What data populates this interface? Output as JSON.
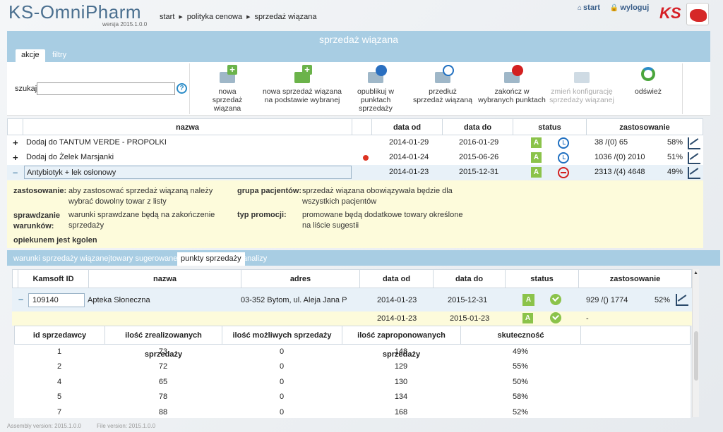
{
  "header": {
    "app_name": "KS-OmniPharm",
    "version": "wersja  2015.1.0.0",
    "breadcrumb": [
      "start",
      "polityka cenowa",
      "sprzedaż wiązana"
    ],
    "link_start": "start",
    "link_logout": "wyloguj",
    "ks_logo": "KS"
  },
  "page_title": "sprzedaż wiązana",
  "tabs": [
    "akcje",
    "filtry"
  ],
  "toolbar": {
    "search_label": "szukaj",
    "search_value": "",
    "help": "?",
    "buttons": [
      {
        "l1": "nowa",
        "l2": "sprzedaż wiązana",
        "enabled": true
      },
      {
        "l1": "nowa sprzedaż wiązana",
        "l2": "na podstawie wybranej",
        "enabled": true
      },
      {
        "l1": "opublikuj w",
        "l2": "punktach sprzedaży",
        "enabled": true
      },
      {
        "l1": "przedłuż",
        "l2": "sprzedaż wiązaną",
        "enabled": true
      },
      {
        "l1": "zakończ w",
        "l2": "wybranych punktach",
        "enabled": true
      },
      {
        "l1": "zmień konfigurację",
        "l2": "sprzedaży wiązanej",
        "enabled": false
      },
      {
        "l1": "odśwież",
        "l2": "",
        "enabled": true
      }
    ]
  },
  "main_table": {
    "columns": [
      "nazwa",
      "data od",
      "data do",
      "status",
      "zastosowanie"
    ],
    "rows": [
      {
        "expander": "+",
        "name": "Dodaj do TANTUM VERDE - PROPOLKI",
        "from": "2014-01-29",
        "to": "2016-01-29",
        "badge": "A",
        "status_icon": "clock-icon",
        "usage": "38 /(0) 65",
        "pct": "58%",
        "flag": false
      },
      {
        "expander": "+",
        "name": "Dodaj do Żelek Marsjanki",
        "from": "2014-01-24",
        "to": "2015-06-26",
        "badge": "A",
        "status_icon": "clock-icon",
        "usage": "1036 /(0) 2010",
        "pct": "51%",
        "flag": true
      },
      {
        "expander": "–",
        "name": "Antybiotyk + lek osłonowy",
        "from": "2014-01-23",
        "to": "2015-12-31",
        "badge": "A",
        "status_icon": "stop-icon",
        "usage": "2313 /(4) 4648",
        "pct": "49%",
        "flag": false
      }
    ]
  },
  "detail": {
    "zast_label": "zastosowanie:",
    "zast_value": "aby zastosować sprzedaż wiązaną należy wybrać dowolny towar z listy",
    "grupa_label": "grupa pacjentów:",
    "grupa_value": "sprzedaż wiązana obowiązywała będzie dla wszystkich pacjentów",
    "spr_label": "sprawdzanie warunków:",
    "spr_value": "warunki sprawdzane będą na zakończenie sprzedaży",
    "typ_label": "typ promocji:",
    "typ_value": "promowane będą dodatkowe towary określone na liście sugestii",
    "owner": "opiekunem jest kgolen"
  },
  "sub_tabs": [
    "warunki sprzedaży wiązanej",
    "towary sugerowane",
    "punkty sprzedaży",
    "analizy"
  ],
  "sub_table": {
    "columns": [
      "Kamsoft ID",
      "nazwa",
      "adres",
      "data od",
      "data do",
      "status",
      "zastosowanie"
    ],
    "row": {
      "expander": "–",
      "id": "109140",
      "name": "Apteka Słoneczna",
      "address": "03-352 Bytom, ul. Aleja Jana Paw",
      "from": "2014-01-23",
      "to": "2015-12-31",
      "badge": "A",
      "usage": "929 /() 1774",
      "pct": "52%"
    },
    "row2": {
      "from": "2014-01-23",
      "to": "2015-01-23",
      "badge": "A",
      "usage": "-"
    }
  },
  "nested_table": {
    "columns": [
      "id sprzedawcy",
      "ilość zrealizowanych sprzedaży",
      "ilość możliwych sprzedaży",
      "ilość zaproponowanych sprzedaży",
      "skuteczność"
    ],
    "rows": [
      {
        "id": "1",
        "done": "73",
        "possible": "0",
        "proposed": "148",
        "eff": "49%"
      },
      {
        "id": "2",
        "done": "72",
        "possible": "0",
        "proposed": "129",
        "eff": "55%"
      },
      {
        "id": "4",
        "done": "65",
        "possible": "0",
        "proposed": "130",
        "eff": "50%"
      },
      {
        "id": "5",
        "done": "78",
        "possible": "0",
        "proposed": "134",
        "eff": "58%"
      },
      {
        "id": "7",
        "done": "88",
        "possible": "0",
        "proposed": "168",
        "eff": "52%"
      }
    ]
  },
  "footer": {
    "assembly": "Assembly version:  2015.1.0.0",
    "file": "File version:  2015.1.0.0"
  },
  "colors": {
    "accent": "#a8cde3",
    "detail_bg": "#fdfbdb",
    "badge_green": "#8bc34a",
    "logo_red": "#d61f26"
  }
}
